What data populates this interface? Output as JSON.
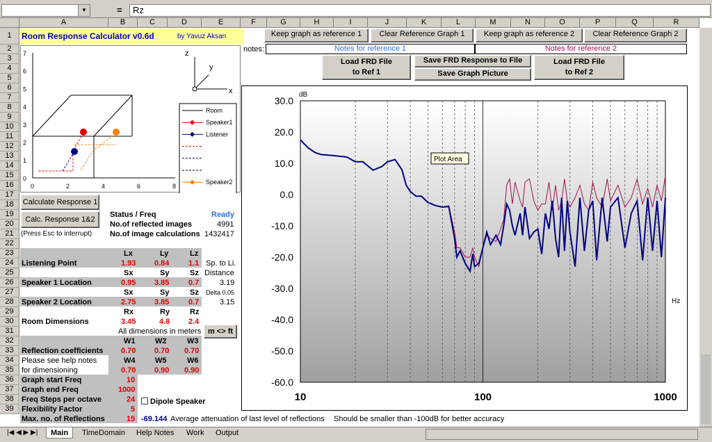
{
  "formula_bar": {
    "name_box": "",
    "equals": "=",
    "formula": "Rz"
  },
  "columns": [
    "A",
    "B",
    "C",
    "D",
    "E",
    "F",
    "G",
    "H",
    "I",
    "J",
    "K",
    "L",
    "M",
    "N",
    "O",
    "P",
    "Q",
    "R"
  ],
  "rows": [
    "1",
    "2",
    "3",
    "4",
    "5",
    "6",
    "7",
    "8",
    "9",
    "10",
    "11",
    "12",
    "13",
    "14",
    "15",
    "16",
    "17",
    "18",
    "19",
    "20",
    "21",
    "22",
    "23",
    "24",
    "25",
    "26",
    "27",
    "28",
    "29",
    "30",
    "31",
    "32",
    "33",
    "34",
    "35",
    "36",
    "37",
    "38",
    "39"
  ],
  "title": {
    "main": "Room Response Calculator  v0.6d",
    "author": "by Yavuz Aksan"
  },
  "buttons": {
    "keep_ref1": "Keep graph as reference 1",
    "clear_ref1": "Clear Reference Graph 1",
    "keep_ref2": "Keep graph as reference 2",
    "clear_ref2": "Clear Reference Graph 2",
    "load_frd1_line1": "Load FRD File",
    "load_frd1_line2": "to Ref 1",
    "save_frd": "Save FRD Response to File",
    "save_pic": "Save Graph Picture",
    "load_frd2_line1": "Load FRD File",
    "load_frd2_line2": "to Ref 2",
    "calc1": "Calculate Response 1",
    "calc12": "Calc. Response 1&2",
    "mft": "m <> ft"
  },
  "notes": {
    "label": "notes:",
    "ref1": "Notes for reference 1",
    "ref2": "Notes for reference 2"
  },
  "room_plot": {
    "y_ticks": [
      "7",
      "6",
      "5",
      "4",
      "3",
      "2",
      "1",
      "0"
    ],
    "x_ticks": [
      "0",
      "2",
      "4",
      "6",
      "8"
    ],
    "axes": {
      "z": "z",
      "y": "y",
      "x": "x"
    },
    "legend": [
      "Room",
      "Speaker1",
      "Listener",
      "",
      "",
      "",
      "Speaker2",
      ""
    ]
  },
  "status": {
    "label": "Status / Freq",
    "value": "Ready",
    "reflected_label": "No.of reflected images",
    "reflected": "4991",
    "calc_label": "No.of image calculations",
    "calc": "1432417",
    "esc": "(Press Esc to interrupt)"
  },
  "table": {
    "lx": "Lx",
    "ly": "Ly",
    "lz": "Lz",
    "listen_label": "Listening Point",
    "listen": [
      "1.93",
      "0.84",
      "1.1"
    ],
    "sp_to_li": "Sp. to Li.",
    "sx": "Sx",
    "sy": "Sy",
    "sz": "Sz",
    "distance": "Distance",
    "sp1_label": "Speaker 1 Location",
    "sp1": [
      "0.95",
      "3.85",
      "0.7"
    ],
    "dist1": "3.19",
    "delta": "Delta 0.05",
    "sp2_label": "Speaker 2 Location",
    "sp2": [
      "2.75",
      "3.85",
      "0.7"
    ],
    "dist2": "3.15",
    "rx": "Rx",
    "ry": "Ry",
    "rz": "Rz",
    "room_label": "Room Dimensions",
    "room": [
      "3.45",
      "4.8",
      "2.4"
    ],
    "all_dims": "All dimensions in meters",
    "w1": "W1",
    "w2": "W2",
    "w3": "W3",
    "refl_label": "Reflection coefficients",
    "refl1": [
      "0.70",
      "0.70",
      "0.70"
    ],
    "help1": "Please see help notes",
    "help2": "for dimensioning",
    "w4": "W4",
    "w5": "W5",
    "w6": "W6",
    "refl2": [
      "0.70",
      "0.90",
      "0.90"
    ],
    "gsf_label": "Graph start Freq",
    "gsf": "10",
    "gef_label": "Graph end Freq",
    "gef": "1000",
    "fspo_label": "Freq Steps per octave",
    "fspo": "24",
    "flex_label": "Flexibility Factor",
    "flex": "5",
    "maxr_label": "Max. no. of Reflections",
    "maxr": "15",
    "dipole": "Dipole Speaker",
    "atten_value": "-69.144",
    "atten_text": "Average attenuation of last level of reflections",
    "atten_note": "Should be smaller than -100dB for better accuracy"
  },
  "graph": {
    "db_label": "dB",
    "hz_label": "Hz",
    "y_ticks": [
      "30.0",
      "20.0",
      "10.0",
      "0.0",
      "-10.0",
      "-20.0",
      "-30.0",
      "-40.0",
      "-50.0",
      "-60.0"
    ],
    "x_ticks": [
      "10",
      "100",
      "1000"
    ],
    "tooltip": "Plot Area"
  },
  "chart_data": {
    "type": "line",
    "xlabel": "Hz",
    "ylabel": "dB",
    "ylim": [
      -60,
      30
    ],
    "xlim": [
      10,
      1000
    ],
    "x_scale": "log",
    "grid": true,
    "series": [
      {
        "name": "",
        "color": "#000080",
        "x": [
          10,
          11,
          12,
          13,
          15,
          18,
          20,
          22,
          25,
          28,
          30,
          33,
          36,
          38,
          40,
          43,
          46,
          50,
          55,
          60,
          65,
          70,
          72,
          75,
          80,
          85,
          88,
          90,
          95,
          100,
          105,
          110,
          118,
          125,
          130,
          135,
          140,
          145,
          150,
          160,
          165,
          170,
          180,
          190,
          200,
          210,
          220,
          230,
          240,
          250,
          260,
          270,
          280,
          290,
          300,
          320,
          340,
          360,
          380,
          400,
          420,
          450,
          480,
          500,
          550,
          600,
          650,
          700,
          750,
          800,
          850,
          900,
          950,
          1000
        ],
        "y": [
          17.5,
          15,
          13.5,
          12.8,
          12.5,
          12,
          10.5,
          10.5,
          7.8,
          9,
          10.5,
          11.2,
          8,
          3,
          1,
          -0.5,
          -0.5,
          -2.5,
          -3.5,
          -4,
          -3.8,
          -14,
          -20,
          -18,
          -22,
          -24.5,
          -19,
          -23,
          -22,
          -17,
          -12,
          -16,
          -13,
          -16,
          -10,
          -3,
          -5,
          -10,
          -13,
          -6,
          -13,
          -4,
          -14,
          -12,
          -11,
          -19,
          -6,
          -11,
          -2,
          -14,
          -20,
          -1,
          -18,
          -2,
          -12,
          -23,
          -1,
          -18,
          -5,
          -2,
          -21,
          -1,
          -15,
          -4,
          -1,
          -17,
          -6,
          -2,
          -21,
          -1,
          -18,
          -2,
          -20,
          -1
        ]
      },
      {
        "name": "",
        "color": "#a01050",
        "x": [
          10,
          11,
          12,
          13,
          15,
          18,
          20,
          22,
          25,
          28,
          30,
          33,
          36,
          38,
          40,
          43,
          46,
          50,
          55,
          60,
          65,
          70,
          72,
          75,
          80,
          85,
          88,
          90,
          95,
          100,
          105,
          110,
          118,
          125,
          130,
          135,
          140,
          145,
          150,
          160,
          165,
          170,
          180,
          190,
          200,
          210,
          220,
          230,
          240,
          250,
          260,
          270,
          280,
          290,
          300,
          320,
          340,
          360,
          380,
          400,
          420,
          450,
          480,
          500,
          550,
          600,
          650,
          700,
          750,
          800,
          850,
          900,
          950,
          1000
        ],
        "y": [
          17.5,
          15,
          13.5,
          12.8,
          12.5,
          12,
          10.5,
          10.5,
          7.8,
          9,
          10.5,
          11.2,
          8,
          3,
          1,
          -0.5,
          -0.5,
          -2.5,
          -3.5,
          -4,
          -3.5,
          -12,
          -17,
          -17,
          -20,
          -20,
          -17,
          -20,
          -23,
          -17,
          -13,
          -14,
          -15,
          -11,
          -8,
          3,
          5,
          -3,
          4,
          -2,
          -4,
          4,
          5,
          -2,
          -5,
          -3,
          -3,
          4,
          -5,
          3,
          -5,
          -2,
          5,
          -2,
          -4,
          -1,
          3,
          -3,
          -5,
          4,
          -1,
          -4,
          5,
          -2,
          3,
          -4,
          -1,
          5,
          -3,
          2,
          -4,
          3,
          -2,
          6
        ]
      }
    ]
  }
}
